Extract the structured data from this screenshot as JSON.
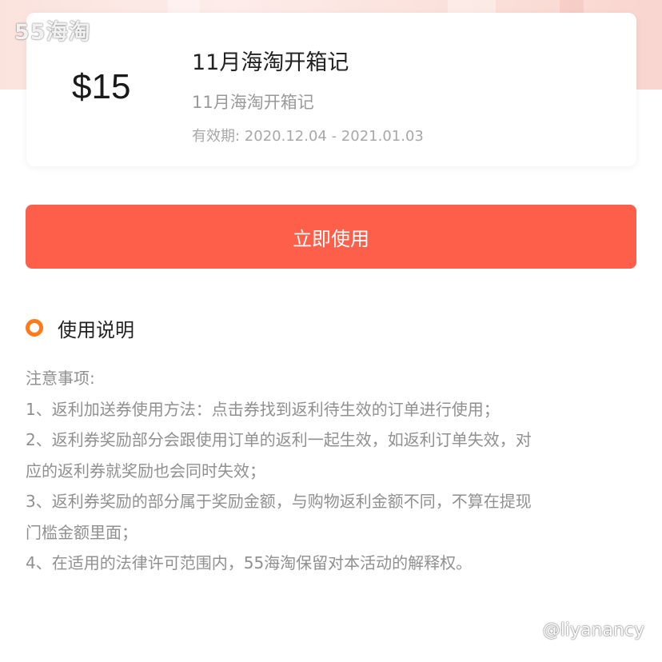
{
  "logo": {
    "text": "55海淘"
  },
  "coupon": {
    "amount": "$15",
    "title": "11月海淘开箱记",
    "subtitle": "11月海淘开箱记",
    "validity": "有效期: 2020.12.04 - 2021.01.03"
  },
  "actions": {
    "use_now_label": "立即使用"
  },
  "instructions": {
    "title": "使用说明",
    "lines": [
      "注意事项:",
      "1、返利加送券使用方法：点击券找到返利待生效的订单进行使用；",
      "2、返利券奖励部分会跟使用订单的返利一起生效，如返利订单失效，对",
      "应的返利券就奖励也会同时失效；",
      "3、返利券奖励的部分属于奖励金额，与购物返利金额不同，不算在提现",
      "门槛金额里面；",
      "4、在适用的法律许可范围内，55海淘保留对本活动的解释权。"
    ]
  },
  "watermark": {
    "user": "@liyanancy"
  },
  "colors": {
    "accent": "#fe5f4a",
    "ring": "#ff7a1a",
    "muted_text": "#909090"
  }
}
